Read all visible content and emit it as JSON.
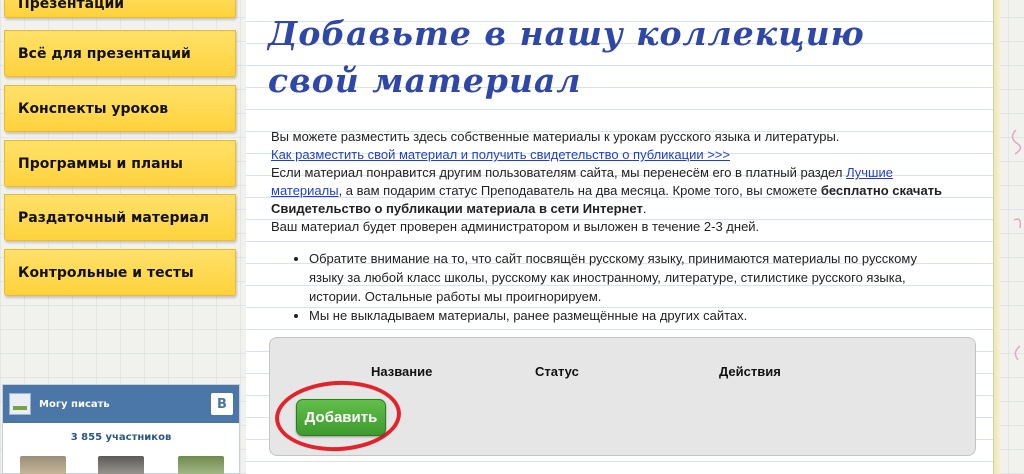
{
  "sidebar": {
    "menu": [
      {
        "label": "Презентации"
      },
      {
        "label": "Всё для презентаций"
      },
      {
        "label": "Конспекты уроков"
      },
      {
        "label": "Программы и планы"
      },
      {
        "label": "Раздаточный материал"
      },
      {
        "label": "Контрольные и тесты"
      }
    ],
    "vk_widget": {
      "group_name": "Могу писать",
      "logo_letter": "B",
      "members": "3 855 участников"
    }
  },
  "main": {
    "title": "Добавьте в нашу коллекцию свой материал",
    "intro": "Вы можете разместить здесь собственные материалы к урокам русского языка и литературы.",
    "howto_link": "Как разместить свой материал и получить свидетельство о публикации >>>",
    "para_part1": "Если материал понравится другим пользователям сайта, мы перенесём его в платный раздел ",
    "best_link": "Лучшие материалы",
    "para_part2": ", а вам подарим статус Преподаватель на два месяца.  Кроме того, вы сможете ",
    "para_bold": "бесплатно скачать Свидетельство о публикации материала в сети Интернет",
    "para_part3": ".",
    "review_note": "Ваш материал будет проверен администратором и выложен в течение 2-3 дней.",
    "bullets": [
      "Обратите внимание на то, что сайт посвящён русскому языку, принимаются материалы по русскому языку за любой класс школы, русскому как иностранному, литературе, стилистике русского языка, истории. Остальные работы мы проигнорируем.",
      "Мы не выкладываем материалы, ранее размещённые на других сайтах."
    ],
    "table": {
      "columns": [
        "Название",
        "Статус",
        "Действия"
      ],
      "add_button": "Добавить"
    }
  },
  "colors": {
    "menu_yellow": "#ffd23c",
    "title_blue": "#2f47a8",
    "link_blue": "#1f3fd0",
    "button_green": "#4fae3a",
    "circle_red": "#e2232b",
    "vk_blue": "#4a76a8"
  }
}
